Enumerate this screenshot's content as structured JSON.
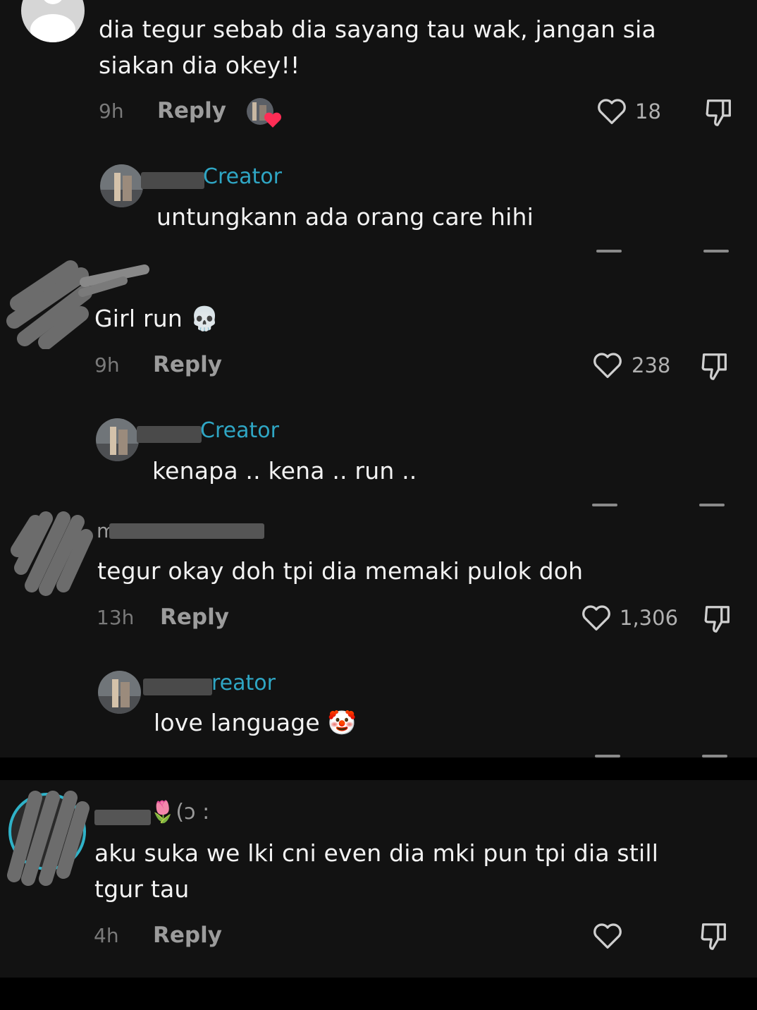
{
  "colors": {
    "background": "#121212",
    "creator_accent": "#2fa6c4",
    "like_heart_red": "#ff2d55"
  },
  "comments": [
    {
      "text_line1": "dia tegur sebab dia sayang tau wak, jangan sia",
      "text_line2": "siakan dia okey!!",
      "time": "9h",
      "reply": "Reply",
      "likes": "18",
      "creator_liked": true,
      "reply_comment": {
        "badge": "Creator",
        "text": "untungkann ada orang care hihi"
      }
    },
    {
      "text": "Girl run 💀",
      "time": "9h",
      "reply": "Reply",
      "likes": "238",
      "reply_comment": {
        "badge": "Creator",
        "text": "kenapa .. kena .. run .."
      }
    },
    {
      "username": "m",
      "text": "tegur okay doh tpi dia memaki pulok doh",
      "time": "13h",
      "reply": "Reply",
      "likes": "1,306",
      "reply_comment": {
        "badge": "reator",
        "text": "love language 🤡"
      }
    },
    {
      "username_suffix": "🌷(ɔ :",
      "text_line1": "aku suka we lki cni even dia mki pun tpi dia still",
      "text_line2": "tgur tau",
      "time": "4h",
      "reply": "Reply",
      "likes": ""
    }
  ],
  "icons": [
    "avatar-icon",
    "heart-icon",
    "dislike-icon",
    "creator-liked-heart-icon"
  ]
}
